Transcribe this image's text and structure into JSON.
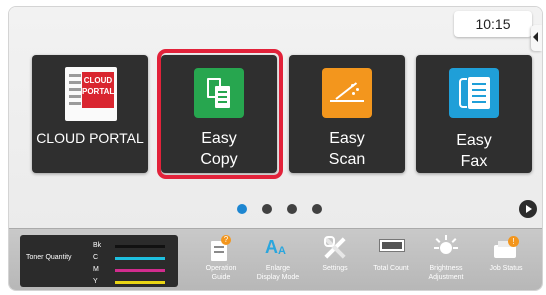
{
  "status": {
    "time": "10:15"
  },
  "tiles": [
    {
      "label": "CLOUD PORTAL",
      "logo_lines": [
        "CLOUD",
        "PORTAL"
      ]
    },
    {
      "label_line1": "Easy",
      "label_line2": "Copy",
      "icon_color": "#27a64f",
      "selected": true
    },
    {
      "label_line1": "Easy",
      "label_line2": "Scan",
      "icon_color": "#f3961d"
    },
    {
      "label_line1": "Easy",
      "label_line2": "Fax",
      "icon_color": "#1f9fd8"
    }
  ],
  "pagination": {
    "count": 4,
    "active_index": 0,
    "active_color": "#1d86d1"
  },
  "toner": {
    "title": "Toner Quantity",
    "levels": [
      {
        "label": "Bk",
        "color": "#111111"
      },
      {
        "label": "C",
        "color": "#1ec0e0"
      },
      {
        "label": "M",
        "color": "#d12c8e"
      },
      {
        "label": "Y",
        "color": "#e9d414"
      }
    ]
  },
  "toolbar": [
    {
      "line1": "Operation",
      "line2": "Guide",
      "icon": "operation-guide-icon"
    },
    {
      "line1": "Enlarge",
      "line2": "Display Mode",
      "icon": "enlarge-display-icon"
    },
    {
      "line1": "Settings",
      "line2": "",
      "icon": "settings-icon"
    },
    {
      "line1": "Total Count",
      "line2": "",
      "icon": "total-count-icon"
    },
    {
      "line1": "Brightness",
      "line2": "Adjustment",
      "icon": "brightness-icon"
    },
    {
      "line1": "Job Status",
      "line2": "",
      "icon": "job-status-icon"
    }
  ],
  "colors": {
    "selection": "#e2223a",
    "tile_bg": "#2f2f2f"
  }
}
